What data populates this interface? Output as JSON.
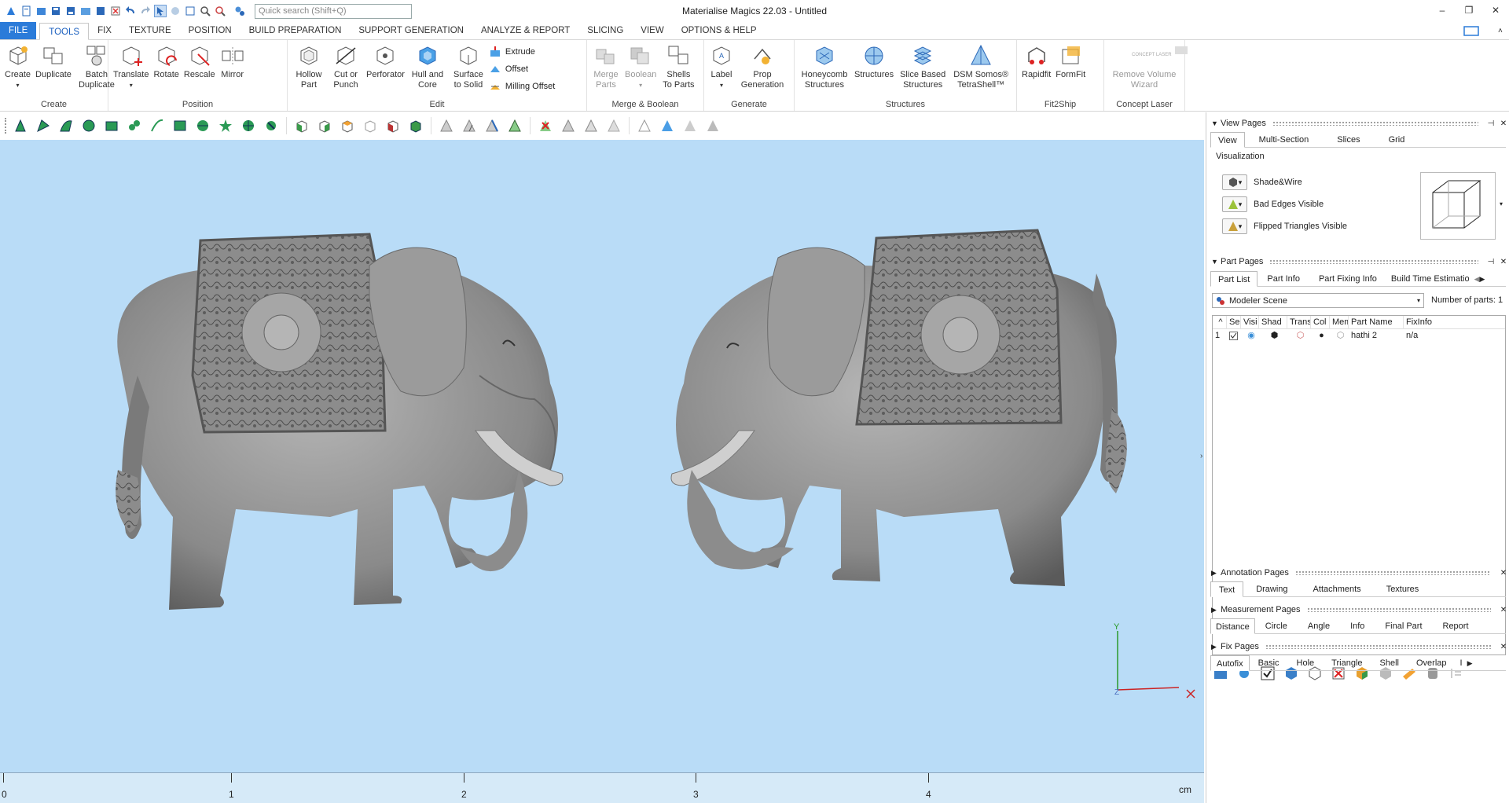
{
  "app": {
    "title": "Materialise Magics 22.03 - Untitled"
  },
  "search": {
    "placeholder": "Quick search (Shift+Q)"
  },
  "window_buttons": [
    "–",
    "❐",
    "✕"
  ],
  "menu": {
    "tabs": [
      "FILE",
      "TOOLS",
      "FIX",
      "TEXTURE",
      "POSITION",
      "BUILD PREPARATION",
      "SUPPORT GENERATION",
      "ANALYZE & REPORT",
      "SLICING",
      "VIEW",
      "OPTIONS & HELP"
    ],
    "active": "TOOLS"
  },
  "ribbon": {
    "groups": [
      {
        "label": "Create",
        "buttons": [
          "Create",
          "Duplicate",
          "Batch Duplicate"
        ]
      },
      {
        "label": "Position",
        "buttons": [
          "Translate",
          "Rotate",
          "Rescale",
          "Mirror"
        ]
      },
      {
        "label": "Edit",
        "buttons": [
          "Hollow Part",
          "Cut or Punch",
          "Perforator",
          "Hull and Core",
          "Surface to Solid"
        ],
        "small": [
          "Extrude",
          "Offset",
          "Milling Offset"
        ]
      },
      {
        "label": "Merge & Boolean",
        "buttons": [
          "Merge Parts",
          "Boolean",
          "Shells To Parts"
        ]
      },
      {
        "label": "Generate",
        "buttons": [
          "Label",
          "Prop Generation"
        ]
      },
      {
        "label": "Structures",
        "buttons": [
          "Honeycomb Structures",
          "Structures",
          "Slice Based Structures",
          "DSM Somos® TetraShell™"
        ]
      },
      {
        "label": "Fit2Ship",
        "buttons": [
          "Rapidfit",
          "FormFit"
        ]
      },
      {
        "label": "Concept Laser",
        "buttons": [
          "Remove Volume Wizard"
        ],
        "badge": "CONCEPT LASER"
      }
    ]
  },
  "viewport": {
    "background": "#b9dcf7",
    "ruler": {
      "labels": [
        "0",
        "1",
        "2",
        "3",
        "4"
      ],
      "unit": "cm"
    },
    "axes": {
      "y": "Y",
      "z": "Z"
    }
  },
  "panels": {
    "view_pages": {
      "title": "View Pages",
      "tabs": [
        "View",
        "Multi-Section",
        "Slices",
        "Grid"
      ],
      "section": "Visualization",
      "options": [
        "Shade&Wire",
        "Bad Edges Visible",
        "Flipped Triangles Visible"
      ]
    },
    "part_pages": {
      "title": "Part Pages",
      "tabs": [
        "Part List",
        "Part Info",
        "Part Fixing Info",
        "Build Time Estimatio"
      ],
      "scene": "Modeler Scene",
      "num_parts_label": "Number of parts:",
      "num_parts": "1",
      "columns": [
        "^",
        "Sele",
        "Visi",
        "Shad",
        "Trans",
        "Col",
        "Mem",
        "Part Name",
        "FixInfo"
      ],
      "rows": [
        {
          "index": "1",
          "name": "hathi 2",
          "fixinfo": "n/a"
        }
      ]
    },
    "annotation_pages": {
      "title": "Annotation Pages",
      "tabs": [
        "Text",
        "Drawing",
        "Attachments",
        "Textures"
      ]
    },
    "measurement_pages": {
      "title": "Measurement Pages",
      "tabs": [
        "Distance",
        "Circle",
        "Angle",
        "Info",
        "Final Part",
        "Report"
      ]
    },
    "fix_pages": {
      "title": "Fix Pages",
      "tabs": [
        "Autofix",
        "Basic",
        "Hole",
        "Triangle",
        "Shell",
        "Overlap",
        "I"
      ]
    }
  },
  "colors": {
    "accent": "#2b7bd9",
    "viewport_bg": "#b9dcf7",
    "model_gray": "#8a8a8a"
  }
}
